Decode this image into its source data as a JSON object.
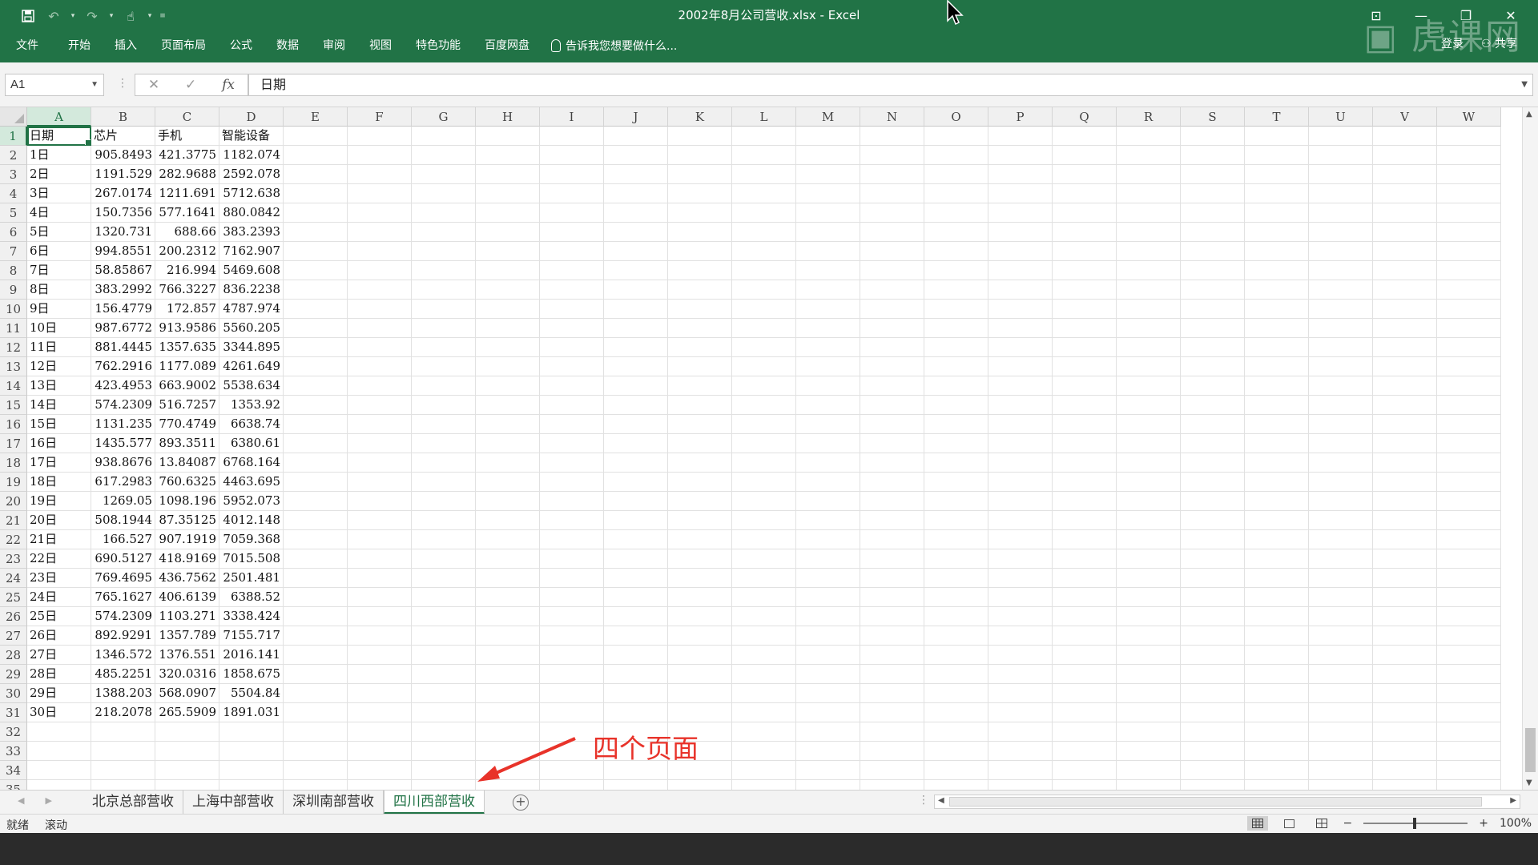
{
  "window": {
    "title": "2002年8月公司营收.xlsx - Excel"
  },
  "watermark": "虎课网",
  "ribbon": {
    "tabs": [
      "文件",
      "开始",
      "插入",
      "页面布局",
      "公式",
      "数据",
      "审阅",
      "视图",
      "特色功能",
      "百度网盘"
    ],
    "tell_me": "告诉我您想要做什么...",
    "login": "登录",
    "share": "共享"
  },
  "formula_bar": {
    "name_box": "A1",
    "cancel_icon": "✕",
    "enter_icon": "✓",
    "fx_label": "fx",
    "value": "日期"
  },
  "columns": [
    "A",
    "B",
    "C",
    "D",
    "E",
    "F",
    "G",
    "H",
    "I",
    "J",
    "K",
    "L",
    "M",
    "N",
    "O",
    "P",
    "Q",
    "R",
    "S",
    "T",
    "U",
    "V",
    "W"
  ],
  "rows": [
    "1",
    "2",
    "3",
    "4",
    "5",
    "6",
    "7",
    "8",
    "9",
    "10",
    "11",
    "12",
    "13",
    "14",
    "15",
    "16",
    "17",
    "18",
    "19",
    "20",
    "21",
    "22",
    "23",
    "24",
    "25",
    "26",
    "27",
    "28",
    "29",
    "30",
    "31",
    "32",
    "33",
    "34",
    "35"
  ],
  "table": {
    "header": [
      "日期",
      "芯片",
      "手机",
      "智能设备"
    ],
    "body": [
      [
        "1日",
        "905.8493",
        "421.3775",
        "1182.074"
      ],
      [
        "2日",
        "1191.529",
        "282.9688",
        "2592.078"
      ],
      [
        "3日",
        "267.0174",
        "1211.691",
        "5712.638"
      ],
      [
        "4日",
        "150.7356",
        "577.1641",
        "880.0842"
      ],
      [
        "5日",
        "1320.731",
        "688.66",
        "383.2393"
      ],
      [
        "6日",
        "994.8551",
        "200.2312",
        "7162.907"
      ],
      [
        "7日",
        "58.85867",
        "216.994",
        "5469.608"
      ],
      [
        "8日",
        "383.2992",
        "766.3227",
        "836.2238"
      ],
      [
        "9日",
        "156.4779",
        "172.857",
        "4787.974"
      ],
      [
        "10日",
        "987.6772",
        "913.9586",
        "5560.205"
      ],
      [
        "11日",
        "881.4445",
        "1357.635",
        "3344.895"
      ],
      [
        "12日",
        "762.2916",
        "1177.089",
        "4261.649"
      ],
      [
        "13日",
        "423.4953",
        "663.9002",
        "5538.634"
      ],
      [
        "14日",
        "574.2309",
        "516.7257",
        "1353.92"
      ],
      [
        "15日",
        "1131.235",
        "770.4749",
        "6638.74"
      ],
      [
        "16日",
        "1435.577",
        "893.3511",
        "6380.61"
      ],
      [
        "17日",
        "938.8676",
        "13.84087",
        "6768.164"
      ],
      [
        "18日",
        "617.2983",
        "760.6325",
        "4463.695"
      ],
      [
        "19日",
        "1269.05",
        "1098.196",
        "5952.073"
      ],
      [
        "20日",
        "508.1944",
        "87.35125",
        "4012.148"
      ],
      [
        "21日",
        "166.527",
        "907.1919",
        "7059.368"
      ],
      [
        "22日",
        "690.5127",
        "418.9169",
        "7015.508"
      ],
      [
        "23日",
        "769.4695",
        "436.7562",
        "2501.481"
      ],
      [
        "24日",
        "765.1627",
        "406.6139",
        "6388.52"
      ],
      [
        "25日",
        "574.2309",
        "1103.271",
        "3338.424"
      ],
      [
        "26日",
        "892.9291",
        "1357.789",
        "7155.717"
      ],
      [
        "27日",
        "1346.572",
        "1376.551",
        "2016.141"
      ],
      [
        "28日",
        "485.2251",
        "320.0316",
        "1858.675"
      ],
      [
        "29日",
        "1388.203",
        "568.0907",
        "5504.84"
      ],
      [
        "30日",
        "218.2078",
        "265.5909",
        "1891.031"
      ]
    ]
  },
  "sheets": [
    "北京总部营收",
    "上海中部营收",
    "深圳南部营收",
    "四川西部营收"
  ],
  "active_sheet": 3,
  "annotation": "四个页面",
  "status": {
    "ready": "就绪",
    "scroll": "滚动",
    "zoom": "100%",
    "zoom_minus": "−",
    "zoom_plus": "+"
  },
  "colors": {
    "accent": "#217346",
    "annotation": "#e8332a"
  }
}
